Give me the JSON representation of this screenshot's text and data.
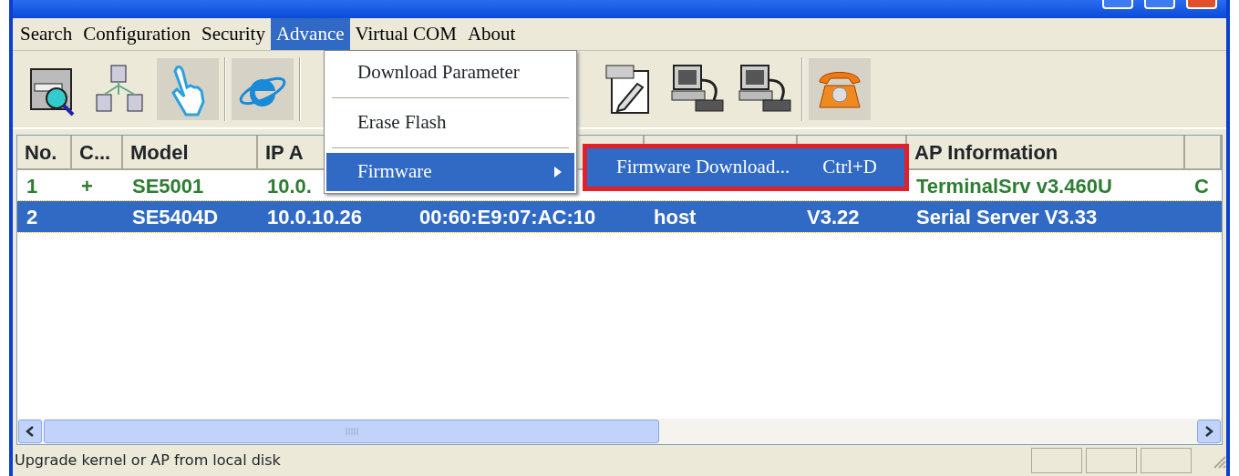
{
  "menu_bar": [
    {
      "label": "Search",
      "selected": false
    },
    {
      "label": "Configuration",
      "selected": false
    },
    {
      "label": "Security",
      "selected": false
    },
    {
      "label": "Advance",
      "selected": true
    },
    {
      "label": "Virtual COM",
      "selected": false
    },
    {
      "label": "About",
      "selected": false
    }
  ],
  "toolbar": [
    {
      "kind": "search",
      "pressed": false
    },
    {
      "kind": "network",
      "pressed": false
    },
    {
      "kind": "hand",
      "pressed": true
    },
    {
      "kind": "browser",
      "pressed": true
    },
    {
      "kind": "gap"
    },
    {
      "kind": "document",
      "pressed": false
    },
    {
      "kind": "computer",
      "pressed": false
    },
    {
      "kind": "computer",
      "pressed": false
    },
    {
      "kind": "phone",
      "pressed": true
    }
  ],
  "table": {
    "columns": [
      "No.",
      "C...",
      "Model",
      "IP A",
      "",
      "",
      "",
      "AP Information",
      ""
    ],
    "rows": [
      {
        "selected": false,
        "cells": [
          "1",
          "+",
          "SE5001",
          "10.0.",
          "",
          "",
          "",
          "TerminalSrv v3.460U",
          "C"
        ]
      },
      {
        "selected": true,
        "cells": [
          "2",
          "",
          "SE5404D",
          "10.0.10.26",
          "00:60:E9:07:AC:10",
          "host",
          "V3.22",
          "Serial Server V3.33",
          ""
        ]
      }
    ]
  },
  "dropdown": {
    "items": [
      {
        "kind": "item",
        "label": "Download Parameter",
        "selected": false
      },
      {
        "kind": "separator"
      },
      {
        "kind": "item",
        "label": "Erase Flash",
        "selected": false
      },
      {
        "kind": "separator"
      },
      {
        "kind": "submenu",
        "label": "Firmware",
        "selected": true
      }
    ]
  },
  "submenu": {
    "items": [
      {
        "label": "Firmware Download...",
        "shortcut": "Ctrl+D",
        "selected": true,
        "highlighted_frame": true
      }
    ]
  },
  "status_bar": {
    "text": "Upgrade kernel or AP from local disk"
  }
}
